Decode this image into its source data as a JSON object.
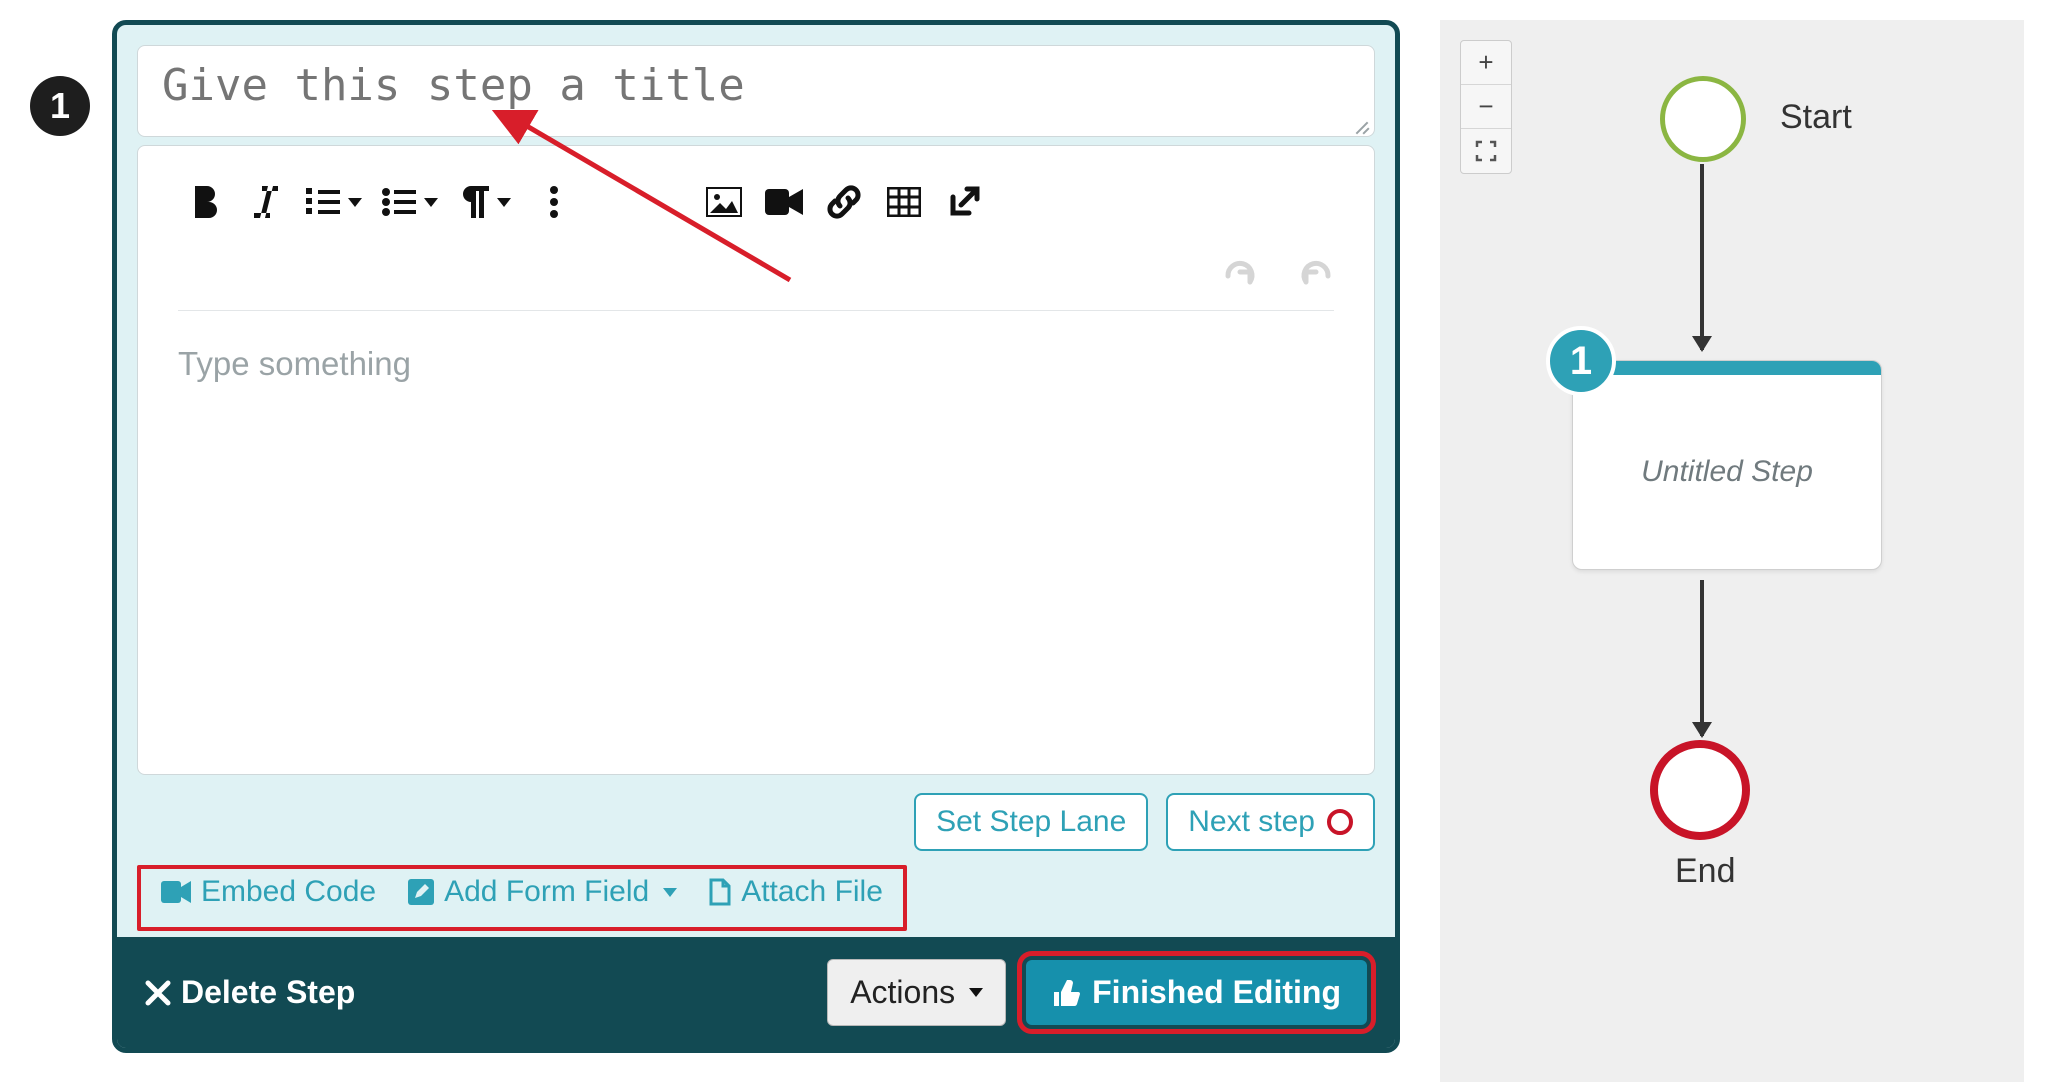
{
  "step_badge": "1",
  "title": {
    "placeholder": "Give this step a title",
    "value": ""
  },
  "editor": {
    "placeholder": "Type something",
    "value": ""
  },
  "buttons": {
    "set_step_lane": "Set Step Lane",
    "next_step": "Next step",
    "embed_code": "Embed Code",
    "add_form_field": "Add Form Field",
    "attach_file": "Attach File",
    "delete_step": "Delete Step",
    "actions": "Actions",
    "finished_editing": "Finished Editing"
  },
  "toolbar_icons": {
    "bold": "bold-icon",
    "italic": "italic-icon",
    "ol": "ordered-list-icon",
    "ul": "unordered-list-icon",
    "para": "paragraph-icon",
    "more": "more-icon",
    "image": "image-icon",
    "video": "video-icon",
    "link": "link-icon",
    "table": "table-icon",
    "popout": "open-external-icon",
    "undo": "undo-icon",
    "redo": "redo-icon"
  },
  "zoom": {
    "in": "+",
    "out": "−",
    "fit": "⛶"
  },
  "flow": {
    "start_label": "Start",
    "end_label": "End",
    "card_badge": "1",
    "card_label": "Untitled Step"
  }
}
